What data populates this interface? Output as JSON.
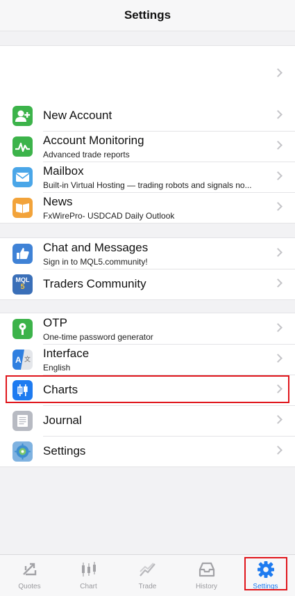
{
  "header": {
    "title": "Settings"
  },
  "account_group": {
    "label": ""
  },
  "services": [
    {
      "label": "New Account",
      "sub": "",
      "icon": "add-user-icon",
      "color": "#3cb34a"
    },
    {
      "label": "Account Monitoring",
      "sub": "Advanced trade reports",
      "icon": "monitoring-icon",
      "color": "#3cb34a"
    },
    {
      "label": "Mailbox",
      "sub": "Built-in Virtual Hosting — trading robots and signals no...",
      "icon": "mail-icon",
      "color": "#4aa6e8"
    },
    {
      "label": "News",
      "sub": "FxWirePro- USDCAD Daily Outlook",
      "icon": "book-icon",
      "color": "#f2a33a"
    }
  ],
  "community": [
    {
      "label": "Chat and Messages",
      "sub": "Sign in to MQL5.community!",
      "icon": "thumbs-up-icon",
      "color": "#3f82d6"
    },
    {
      "label": "Traders Community",
      "sub": "",
      "icon": "mql5-icon",
      "color": "#3a6fb8",
      "icon_text": "MQL5"
    }
  ],
  "tools": [
    {
      "label": "OTP",
      "sub": "One-time password generator",
      "icon": "key-icon",
      "color": "#3cb34a"
    },
    {
      "label": "Interface",
      "sub": "English",
      "icon": "language-icon",
      "color": "#2f7fe0",
      "icon_text": "A"
    },
    {
      "label": "Charts",
      "sub": "",
      "icon": "candlestick-icon",
      "color": "#1e7bf0"
    },
    {
      "label": "Journal",
      "sub": "",
      "icon": "journal-icon",
      "color": "#b7bac2"
    },
    {
      "label": "Settings",
      "sub": "",
      "icon": "settings-app-icon",
      "color": "#7fb2e0"
    }
  ],
  "tabbar": {
    "tabs": [
      {
        "label": "Quotes",
        "icon": "quotes-icon",
        "active": false
      },
      {
        "label": "Chart",
        "icon": "chart-icon",
        "active": false
      },
      {
        "label": "Trade",
        "icon": "trade-icon",
        "active": false
      },
      {
        "label": "History",
        "icon": "history-icon",
        "active": false
      },
      {
        "label": "Settings",
        "icon": "gear-icon",
        "active": true
      }
    ],
    "active_color": "#1e7bf0",
    "inactive_color": "#9a9a9e"
  },
  "highlight_color": "#e0151b"
}
